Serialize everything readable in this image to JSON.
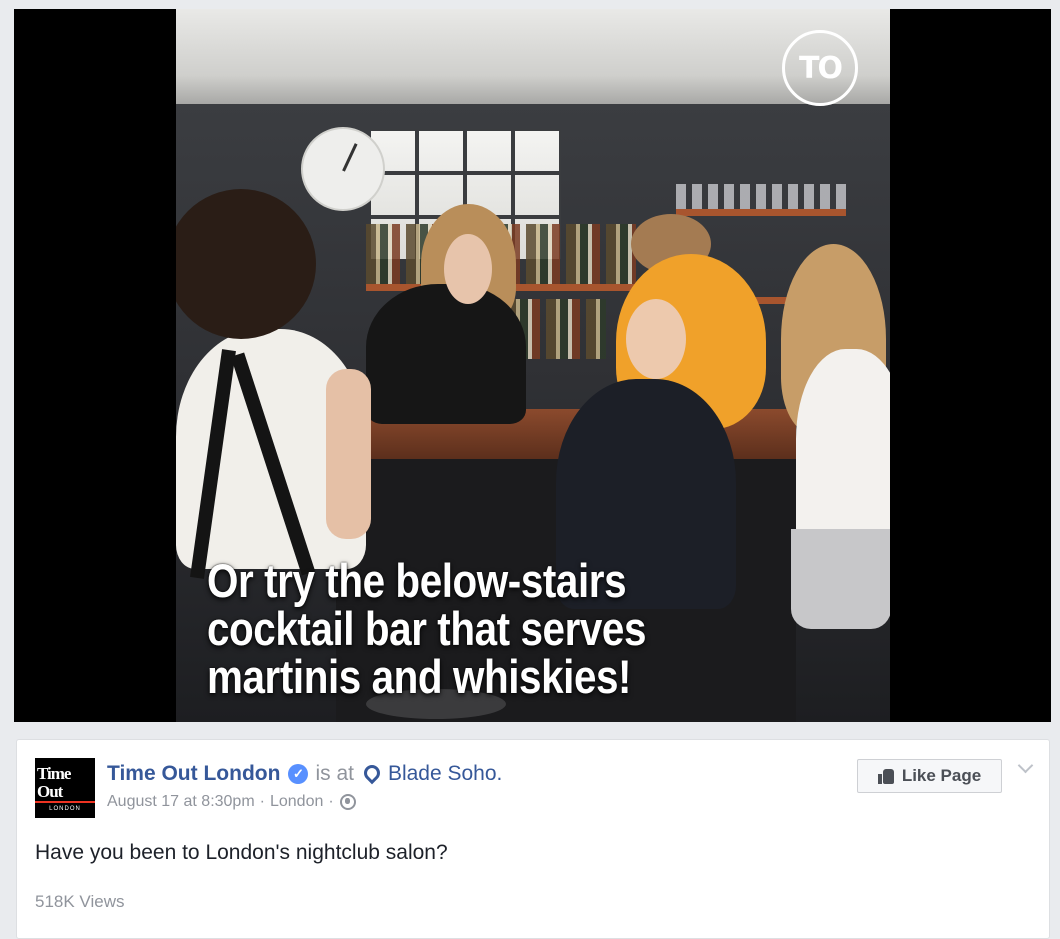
{
  "video": {
    "caption_lines": [
      "Or try the below-stairs",
      "cocktail bar that serves",
      "martinis and whiskies!"
    ],
    "watermark": "TO"
  },
  "post": {
    "avatar_logo": "Time Out",
    "avatar_logo_sub": "LONDON",
    "page_name": "Time Out London",
    "verified_icon": "verified-badge-icon",
    "is_at": "is at",
    "place": "Blade Soho.",
    "date": "August 17 at 8:30pm",
    "separator": "·",
    "location": "London",
    "audience_icon": "globe-icon",
    "like_page_label": "Like Page",
    "text": "Have you been to London's nightclub salon?",
    "views": "518K Views"
  },
  "colors": {
    "link_blue": "#365899",
    "verified_blue": "#5890ff",
    "meta_gray": "#90949c",
    "background": "#e9ebee"
  }
}
